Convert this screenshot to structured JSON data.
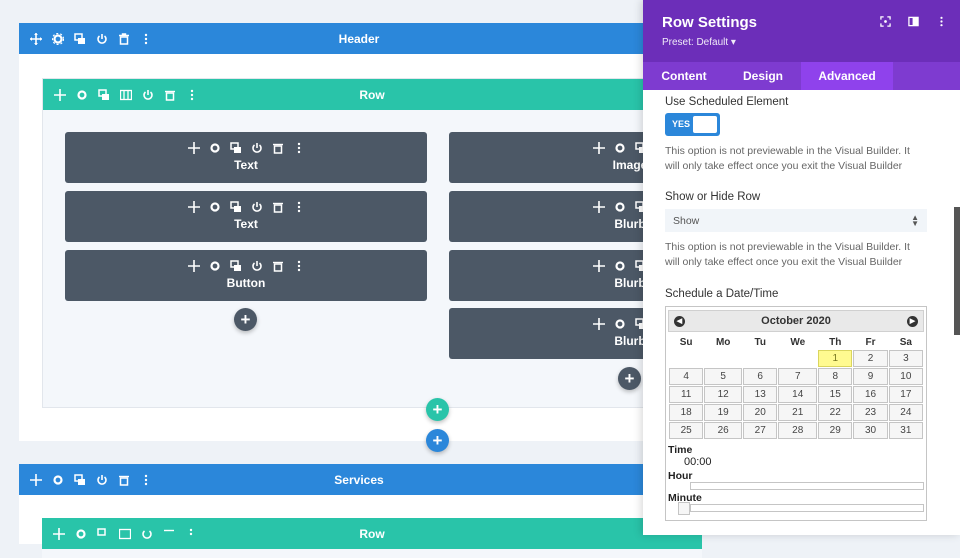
{
  "sections": [
    {
      "title": "Header"
    },
    {
      "title": "Services"
    }
  ],
  "rows": [
    {
      "title": "Row"
    },
    {
      "title": "Row"
    }
  ],
  "modules": {
    "col1": [
      "Text",
      "Text",
      "Button"
    ],
    "col2": [
      "Image",
      "Blurb",
      "Blurb",
      "Blurb"
    ]
  },
  "add_symbol": "+",
  "colors": {
    "section": "#2b87da",
    "row": "#29c4a9",
    "module": "#4c5866",
    "panel_head": "#6c2eb9",
    "accent": "#8f42ec"
  },
  "panel": {
    "title": "Row Settings",
    "preset": "Preset: Default ▾",
    "tabs": [
      "Content",
      "Design",
      "Advanced"
    ],
    "active_tab": "Advanced",
    "scheduled_label": "Use Scheduled Element",
    "toggle_value": "YES",
    "note1": "This option is not previewable in the Visual Builder. It will only take effect once you exit the Visual Builder",
    "show_hide_label": "Show or Hide Row",
    "show_hide_value": "Show",
    "note2": "This option is not previewable in the Visual Builder. It will only take effect once you exit the Visual Builder",
    "schedule_label": "Schedule a Date/Time",
    "calendar": {
      "month": "October 2020",
      "weekdays": [
        "Su",
        "Mo",
        "Tu",
        "We",
        "Th",
        "Fr",
        "Sa"
      ],
      "weeks": [
        [
          "",
          "",
          "",
          "",
          "1",
          "2",
          "3"
        ],
        [
          "4",
          "5",
          "6",
          "7",
          "8",
          "9",
          "10"
        ],
        [
          "11",
          "12",
          "13",
          "14",
          "15",
          "16",
          "17"
        ],
        [
          "18",
          "19",
          "20",
          "21",
          "22",
          "23",
          "24"
        ],
        [
          "25",
          "26",
          "27",
          "28",
          "29",
          "30",
          "31"
        ]
      ],
      "highlighted": "1"
    },
    "time_label": "Time",
    "time_value": "00:00",
    "hour_label": "Hour",
    "minute_label": "Minute"
  }
}
